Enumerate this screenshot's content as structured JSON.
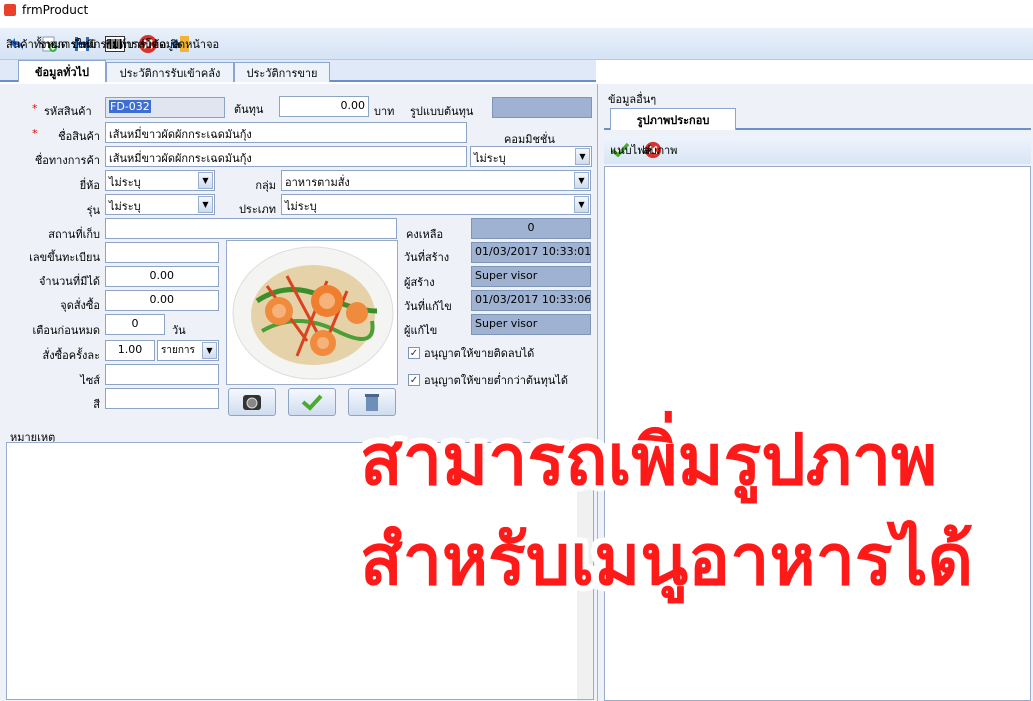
{
  "window": {
    "title": "frmProduct"
  },
  "toolbar": {
    "all_products": "สินค้าทั้งหมด",
    "new_item": "รายการใหม่",
    "save_item": "บันทึกรายการ",
    "print_barcode": "พิมพ์บาร์โค้ด",
    "delete_data": "ลบข้อมูล",
    "close_page": "ปิดหน้าจอ"
  },
  "tabs": [
    "ข้อมูลทั่วไป",
    "ประวัติการรับเข้าคลัง",
    "ประวัติการขาย"
  ],
  "form": {
    "labels": {
      "required_mark": "*",
      "product_code": "รหัสสินค้า",
      "cost": "ต้นทุน",
      "baht": "บาท",
      "cost_format": "รูปแบบต้นทุน",
      "product_name": "ชื่อสินค้า",
      "commission": "คอมมิชชั่น",
      "trade_name": "ชื่อทางการค้า",
      "brand": "ยี่ห้อ",
      "group": "กลุ่ม",
      "model": "รุ่น",
      "type": "ประเภท",
      "storage": "สถานที่เก็บ",
      "remaining": "คงเหลือ",
      "registration": "เลขขึ้นทะเบียน",
      "created_date": "วันที่สร้าง",
      "qty_available": "จำนวนที่มีได้",
      "creator": "ผู้สร้าง",
      "reorder_point": "จุดสั่งซื้อ",
      "modified_date": "วันที่แก้ไข",
      "expiry_warn": "เตือนก่อนหมด",
      "days": "วัน",
      "modifier": "ผู้แก้ไข",
      "order_per_time": "สั่งซื้อครั้งละ",
      "size": "ไซส์",
      "color": "สี",
      "remark": "หมายเหตุ"
    },
    "values": {
      "product_code": "FD-032",
      "cost": "0.00",
      "product_name": "เส้นหมี่ขาวผัดผักกระเฉดมันกุ้ง",
      "trade_name": "เส้นหมี่ขาวผัดผักกระเฉดมันกุ้ง",
      "commission": "ไม่ระบุ",
      "brand": "ไม่ระบุ",
      "group": "อาหารตามสั่ง",
      "model": "ไม่ระบุ",
      "type": "ไม่ระบุ",
      "remaining": "0",
      "created_date": "01/03/2017 10:33:01",
      "qty_available": "0.00",
      "creator": "Super visor",
      "reorder_point": "0.00",
      "modified_date": "01/03/2017 10:33:06",
      "expiry_warn": "0",
      "modifier": "Super visor",
      "order_per_time": "1.00",
      "order_unit": "รายการ"
    },
    "checkboxes": {
      "allow_negative": "อนุญาตให้ขายติดลบได้",
      "allow_below_cost": "อนุญาตให้ขายต่ำกว่าต้นทุนได้"
    }
  },
  "right_panel": {
    "title": "ข้อมูลอื่นๆ",
    "tab": "รูปภาพประกอบ",
    "attach_file": "แนบไฟล์",
    "delete_image": "ลบภาพ"
  },
  "overlay": {
    "line1": "สามารถเพิ่มรูปภาพ",
    "line2": "สำหรับเมนูอาหารได้"
  },
  "colors": {
    "overlay_text": "#ff1a1a",
    "accent_blue": "#6b8fc9",
    "readonly_field": "#9fb2d1"
  }
}
